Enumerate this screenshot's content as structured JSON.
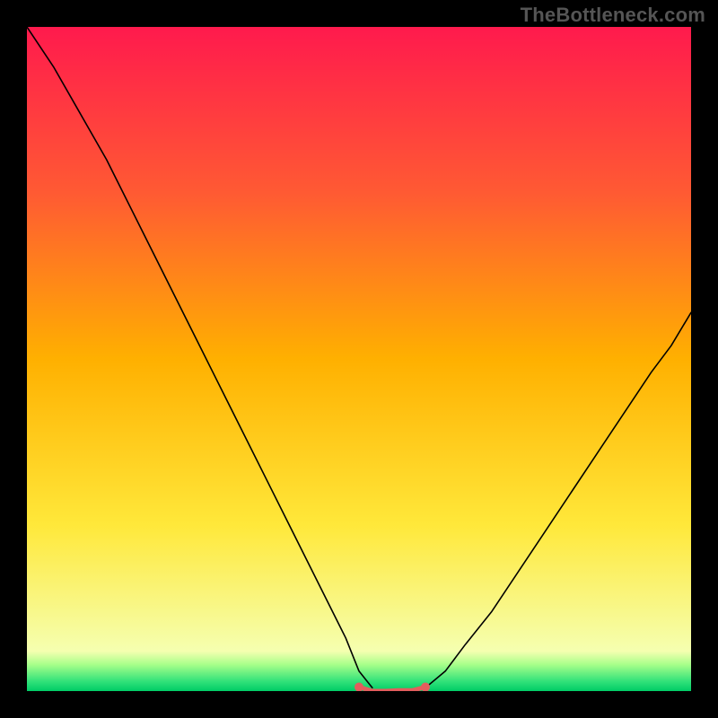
{
  "watermark": "TheBottleneck.com",
  "chart_data": {
    "type": "line",
    "title": "",
    "xlabel": "",
    "ylabel": "",
    "xlim": [
      0,
      100
    ],
    "ylim": [
      0,
      100
    ],
    "grid": false,
    "legend": false,
    "gradient_stops": [
      {
        "offset": 0.0,
        "color": "#ff1a4d"
      },
      {
        "offset": 0.25,
        "color": "#ff5a33"
      },
      {
        "offset": 0.5,
        "color": "#ffb000"
      },
      {
        "offset": 0.75,
        "color": "#ffe83a"
      },
      {
        "offset": 0.94,
        "color": "#f5ffb0"
      },
      {
        "offset": 0.96,
        "color": "#a8ff8a"
      },
      {
        "offset": 0.985,
        "color": "#33e27a"
      },
      {
        "offset": 1.0,
        "color": "#00cc66"
      }
    ],
    "series": [
      {
        "name": "left-curve",
        "stroke": "#000000",
        "stroke_width": 1.6,
        "x": [
          0,
          4,
          8,
          12,
          16,
          20,
          24,
          28,
          32,
          36,
          40,
          44,
          48,
          50,
          52
        ],
        "y": [
          100,
          94,
          87,
          80,
          72,
          64,
          56,
          48,
          40,
          32,
          24,
          16,
          8,
          3,
          0.5
        ]
      },
      {
        "name": "right-curve",
        "stroke": "#000000",
        "stroke_width": 1.6,
        "x": [
          60,
          63,
          66,
          70,
          74,
          78,
          82,
          86,
          90,
          94,
          97,
          100
        ],
        "y": [
          0.5,
          3,
          7,
          12,
          18,
          24,
          30,
          36,
          42,
          48,
          52,
          57
        ]
      },
      {
        "name": "bottom-marker",
        "stroke": "#e35d5d",
        "stroke_width": 5,
        "x": [
          50,
          52,
          54,
          56,
          58,
          60
        ],
        "y": [
          0.6,
          0.0,
          0.0,
          0.1,
          0.1,
          0.6
        ]
      }
    ],
    "bottom_dots": [
      {
        "x": 50,
        "y": 0.6
      },
      {
        "x": 60,
        "y": 0.6
      }
    ]
  }
}
